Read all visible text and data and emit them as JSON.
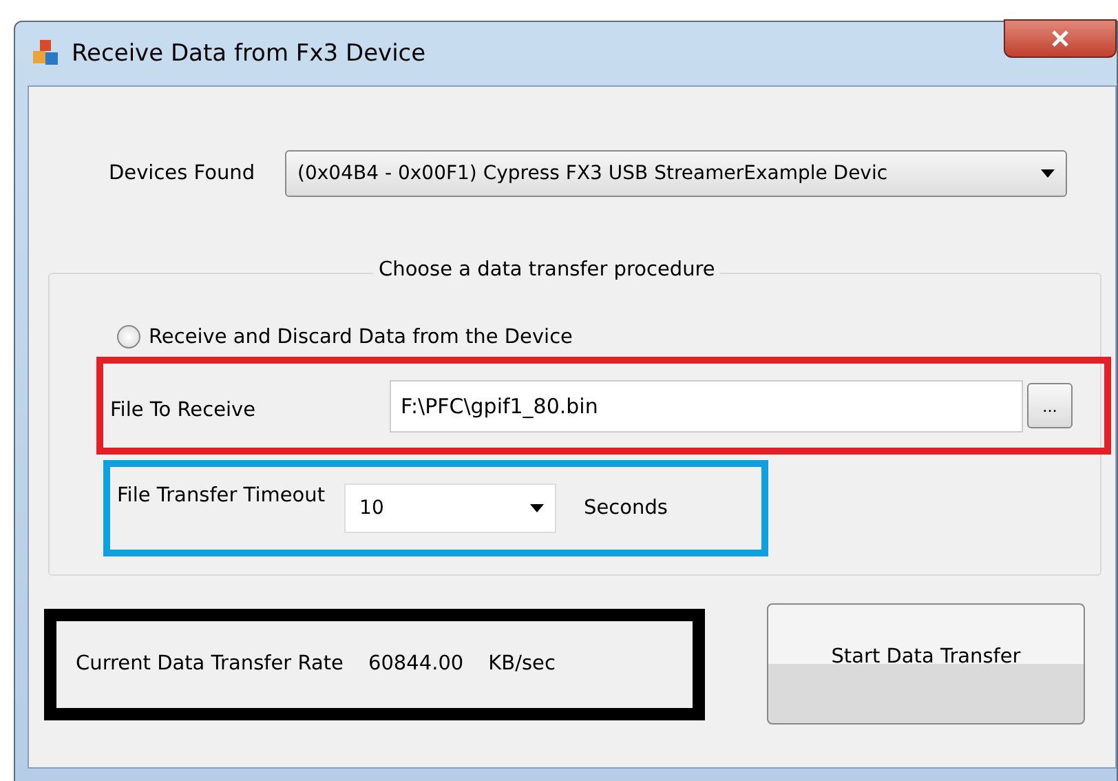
{
  "window": {
    "title": "Receive Data from Fx3 Device"
  },
  "devices": {
    "label": "Devices Found",
    "value": "(0x04B4 - 0x00F1) Cypress FX3 USB StreamerExample Devic"
  },
  "procedure": {
    "title": "Choose a data transfer procedure",
    "discard_option": {
      "label": "Receive and Discard Data from the Device",
      "selected": false
    },
    "file": {
      "label": "File To Receive",
      "value": "F:\\PFC\\gpif1_80.bin",
      "browse": "...",
      "color": "#e32028"
    },
    "timeout": {
      "label": "File Transfer Timeout",
      "value": "10",
      "unit": "Seconds",
      "color": "#0ea0e0"
    }
  },
  "rate": {
    "label": "Current Data Transfer Rate",
    "value": "60844.00",
    "unit": "KB/sec",
    "color": "#000000"
  },
  "start_button": "Start Data Transfer"
}
